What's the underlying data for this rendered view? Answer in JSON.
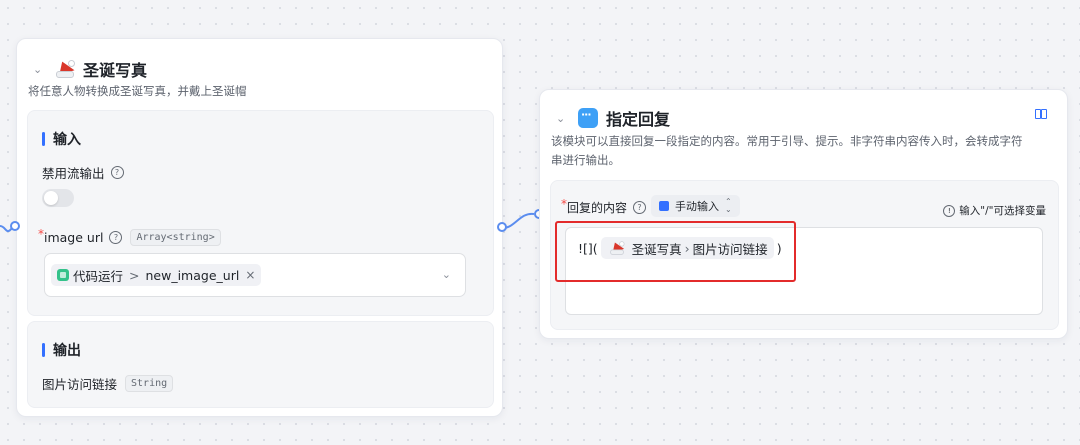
{
  "left_node": {
    "title": "圣诞写真",
    "description": "将任意人物转换成圣诞写真，并戴上圣诞帽",
    "input": {
      "section_title": "输入",
      "stream_label": "禁用流输出",
      "stream_enabled": false,
      "image_field": {
        "required_mark": "*",
        "label": "image url",
        "type": "Array<string>",
        "ref_source": "代码运行",
        "ref_separator": ">",
        "ref_variable": "new_image_url",
        "remove_glyph": "×"
      }
    },
    "output": {
      "section_title": "输出",
      "var_name": "图片访问链接",
      "var_type": "String"
    }
  },
  "right_node": {
    "title": "指定回复",
    "description_line1": "该模块可以直接回复一段指定的内容。常用于引导、提示。非字符串内容传入时，会转成字符",
    "description_line2": "串进行输出。",
    "content": {
      "required_mark": "*",
      "label": "回复的内容",
      "mode": "手动输入",
      "hint": "输入\"/\"可选择变量",
      "prefix": "![](",
      "ref_node": "圣诞写真",
      "ref_separator": "›",
      "ref_variable": "图片访问链接",
      "suffix": ")"
    }
  },
  "colors": {
    "accent": "#3370ff",
    "highlight": "#e32b2b",
    "port": "#5b8def"
  },
  "icons": [
    "chevron-down-icon",
    "santa-hat-icon",
    "message-icon",
    "book-icon",
    "help-icon",
    "info-icon",
    "code-run-icon"
  ]
}
